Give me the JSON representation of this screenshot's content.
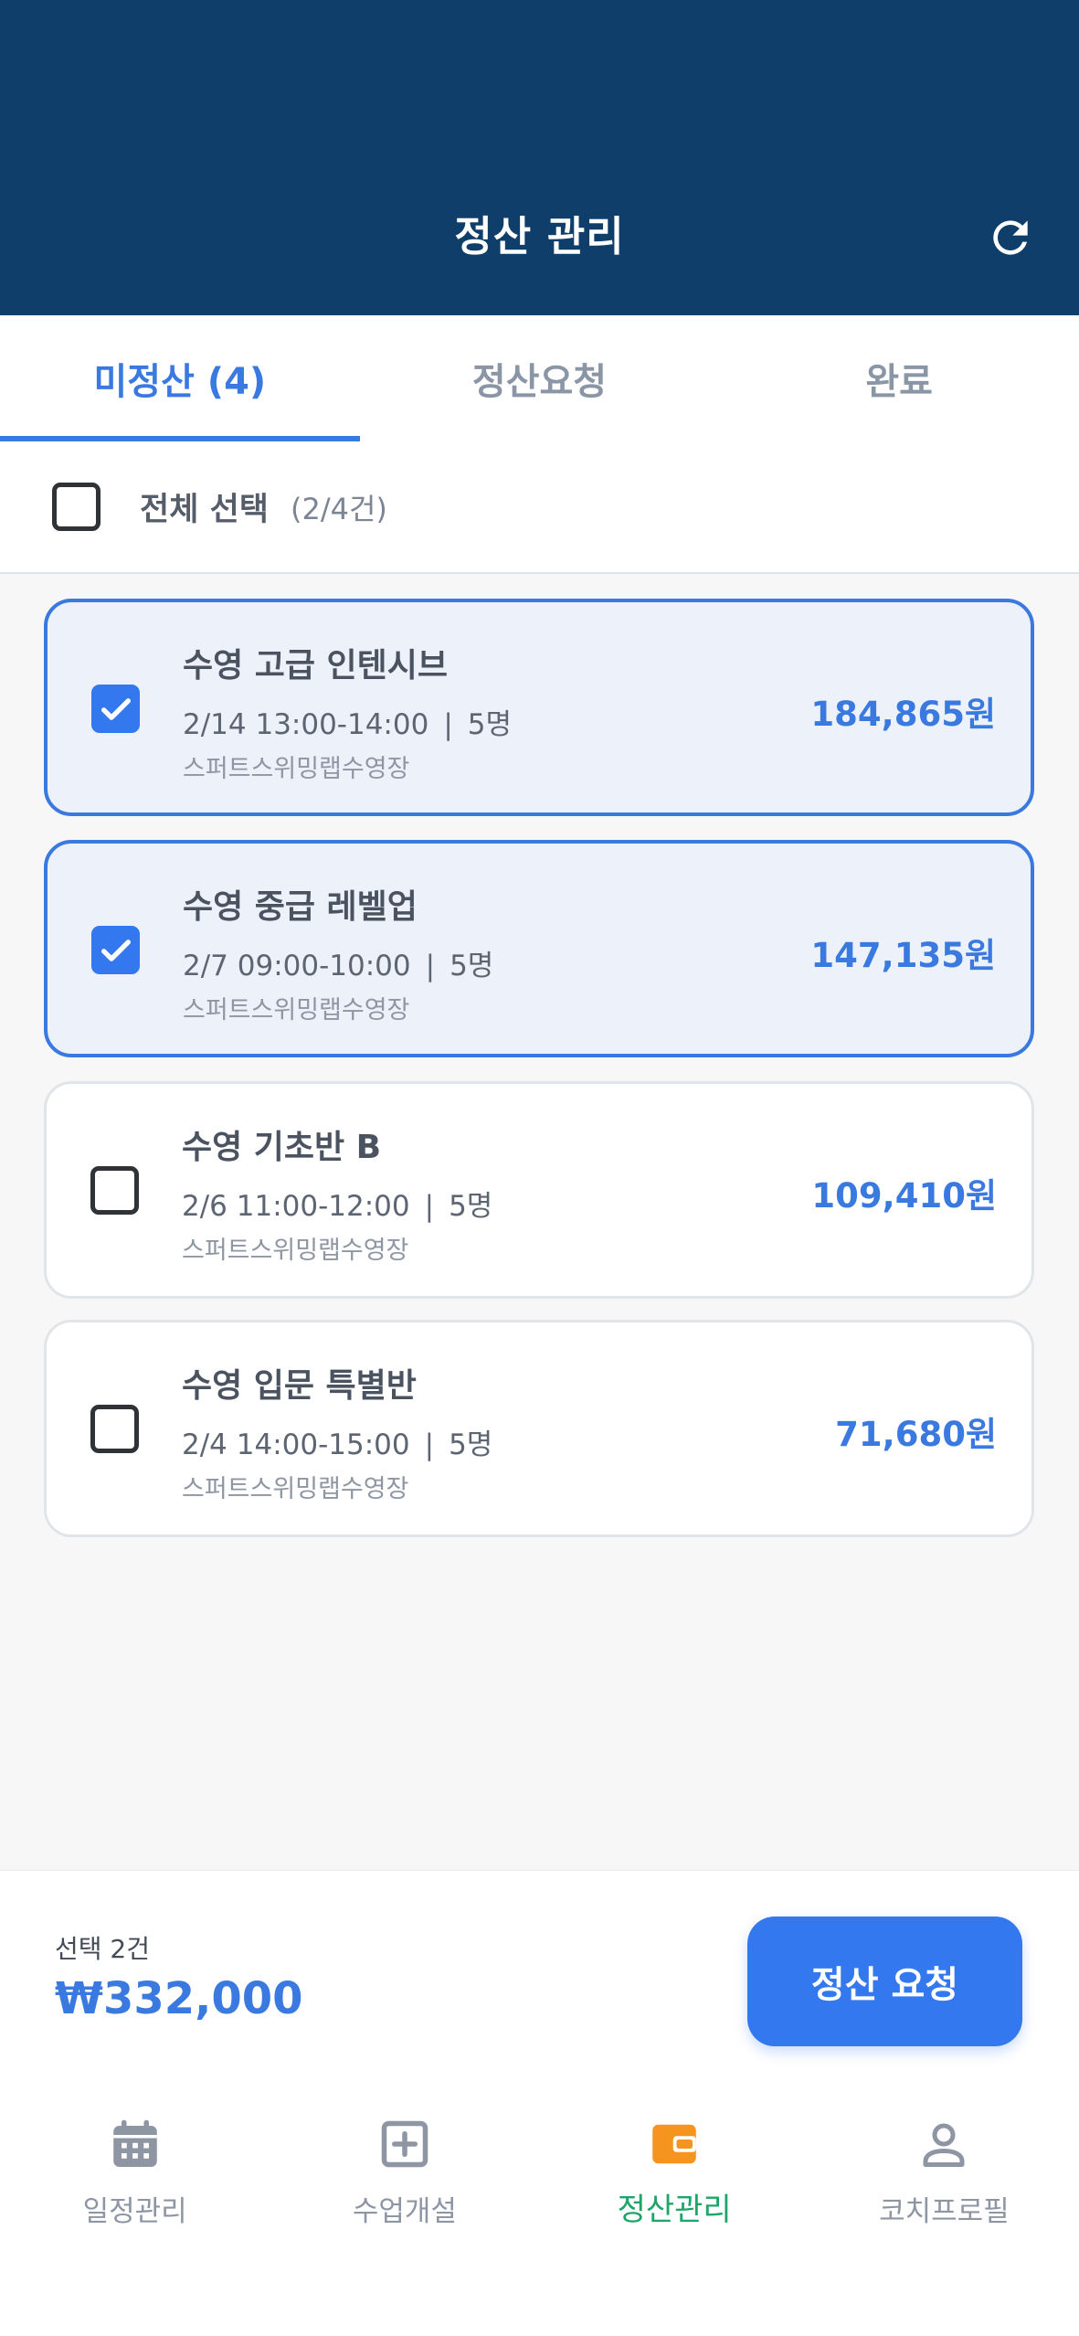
{
  "header": {
    "title": "정산 관리"
  },
  "tabs": [
    {
      "label": "미정산 (4)"
    },
    {
      "label": "정산요청"
    },
    {
      "label": "완료"
    }
  ],
  "select_all": {
    "label": "전체 선택",
    "count": "(2/4건)"
  },
  "items": [
    {
      "title": "수영 고급 인텐시브",
      "date_time": "2/14 13:00-14:00",
      "people": "5명",
      "venue": "스퍼트스위밍랩수영장",
      "amount": "184,865원",
      "checked": true
    },
    {
      "title": "수영 중급 레벨업",
      "date_time": "2/7 09:00-10:00",
      "people": "5명",
      "venue": "스퍼트스위밍랩수영장",
      "amount": "147,135원",
      "checked": true
    },
    {
      "title": "수영 기초반 B",
      "date_time": "2/6 11:00-12:00",
      "people": "5명",
      "venue": "스퍼트스위밍랩수영장",
      "amount": "109,410원",
      "checked": false
    },
    {
      "title": "수영 입문 특별반",
      "date_time": "2/4 14:00-15:00",
      "people": "5명",
      "venue": "스퍼트스위밍랩수영장",
      "amount": "71,680원",
      "checked": false
    }
  ],
  "summary": {
    "count": "선택 2건",
    "total": "₩332,000",
    "button_label": "정산 요청"
  },
  "nav": [
    {
      "label": "일정관리",
      "icon": "calendar-icon"
    },
    {
      "label": "수업개설",
      "icon": "plus-square-icon"
    },
    {
      "label": "정산관리",
      "icon": "wallet-icon",
      "active": true
    },
    {
      "label": "코치프로필",
      "icon": "person-icon"
    }
  ],
  "colors": {
    "header": "#0f3e6a",
    "accent": "#3a7ae0",
    "nav_active": "#1fa56a",
    "wallet": "#f5941f"
  }
}
